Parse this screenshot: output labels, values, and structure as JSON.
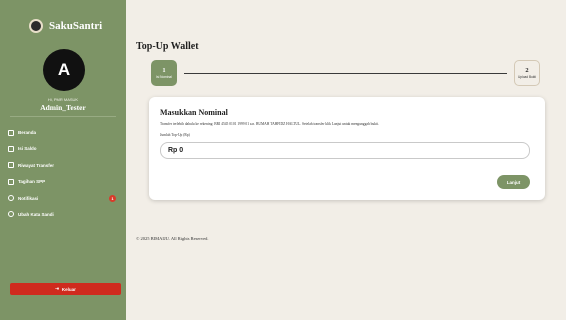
{
  "sidebar": {
    "app_name": "SakuSantri",
    "avatar_initial": "A",
    "role": "Hi, PMR MASUK",
    "username": "Admin_Tester",
    "items": [
      {
        "label": "Beranda",
        "icon": "home-icon"
      },
      {
        "label": "Isi Saldo",
        "icon": "wallet-icon"
      },
      {
        "label": "Riwayat Transfer",
        "icon": "history-icon"
      },
      {
        "label": "Tagihan SPP",
        "icon": "bill-icon"
      },
      {
        "label": "Notifikasi",
        "icon": "bell-icon",
        "badge": "1"
      },
      {
        "label": "Ubah Kata Sandi",
        "icon": "key-icon"
      }
    ],
    "logout_label": "Keluar"
  },
  "main": {
    "title": "Top-Up Wallet",
    "steps": [
      {
        "number": "1",
        "label": "Isi Nominal"
      },
      {
        "number": "2",
        "label": "Upload Bukti"
      }
    ],
    "card": {
      "title": "Masukkan Nominal",
      "description": "Transfer terlebih dahulu ke rekening: BRI 4545 0101 1999 01 a.n. BUMAH TAHFIDZ HALTUL. Setelah transfer klik Lanjut untuk mengunggah bukti.",
      "field_label": "Jumlah Top-Up (Rp)",
      "field_value": "Rp 0",
      "next_label": "Lanjut"
    },
    "footer": "© 2025 BIMAIJU. All Rights Reserved."
  },
  "colors": {
    "sidebar": "#7d9466",
    "background": "#f2eee7",
    "logout": "#cf2a1e",
    "badge": "#d93a2a"
  }
}
